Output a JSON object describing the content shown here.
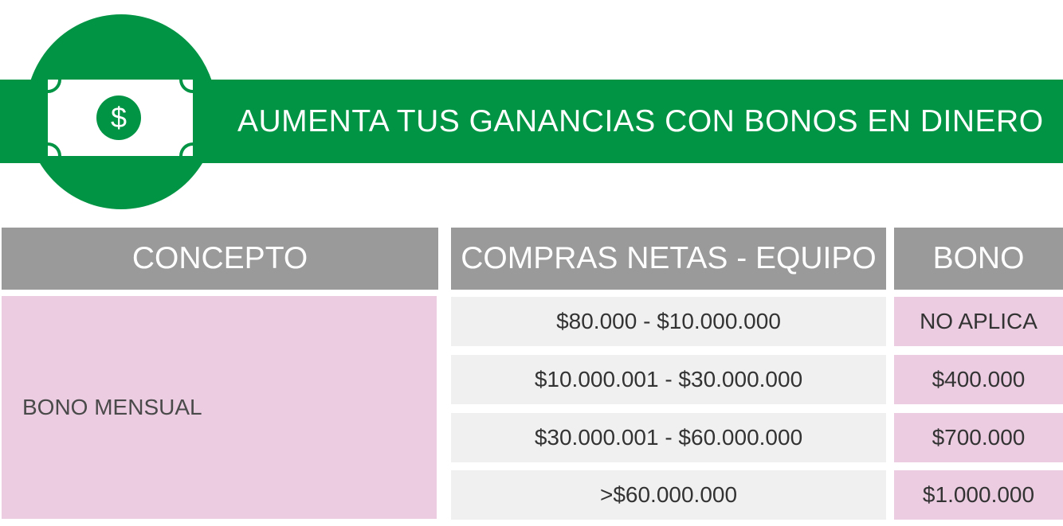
{
  "header": {
    "title": "AUMENTA TUS GANANCIAS CON BONOS EN DINERO",
    "icon_symbol": "$",
    "icon": "money-bill-icon",
    "brand_color": "#009444"
  },
  "table": {
    "columns": [
      "CONCEPTO",
      "COMPRAS NETAS - EQUIPO",
      "BONO"
    ],
    "concept": "BONO MENSUAL",
    "rows": [
      {
        "range": "$80.000 - $10.000.000",
        "bono": "NO APLICA"
      },
      {
        "range": "$10.000.001 - $30.000.000",
        "bono": "$400.000"
      },
      {
        "range": "$30.000.001 - $60.000.000",
        "bono": "$700.000"
      },
      {
        "range": ">$60.000.000",
        "bono": "$1.000.000"
      }
    ],
    "header_color": "#9a9a9a",
    "pink_color": "#ebcce1",
    "light_color": "#f0f0f0"
  }
}
